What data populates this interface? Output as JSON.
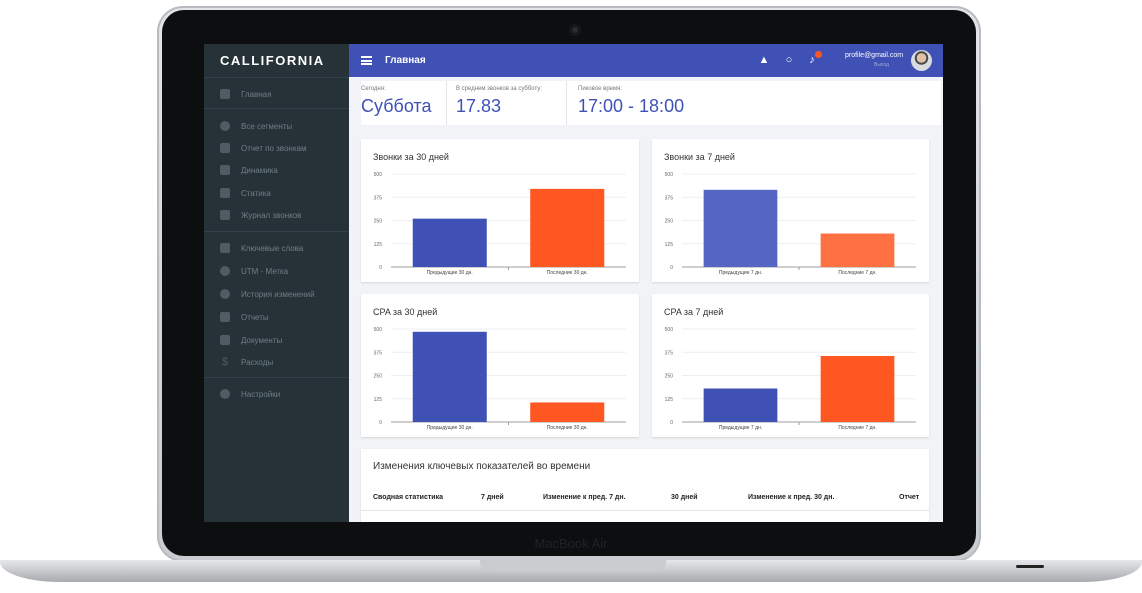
{
  "app": {
    "logo": "CALLIFORNIA",
    "page_title": "Главная"
  },
  "device": {
    "brand": "MacBook Air"
  },
  "sidebar": {
    "items": [
      {
        "label": "Главная",
        "icon": "home-icon"
      },
      {
        "label": "Все сегменты",
        "icon": "segments-icon"
      },
      {
        "label": "Отчет по звонкам",
        "icon": "phone-icon"
      },
      {
        "label": "Динамика",
        "icon": "bar-chart-icon"
      },
      {
        "label": "Статика",
        "icon": "columns-icon"
      },
      {
        "label": "Журнал звонков",
        "icon": "journal-icon"
      },
      {
        "label": "Ключевые слова",
        "icon": "tag-icon"
      },
      {
        "label": "UTM - Метка",
        "icon": "search-icon"
      },
      {
        "label": "История изменений",
        "icon": "history-icon"
      },
      {
        "label": "Отчеты",
        "icon": "report-icon"
      },
      {
        "label": "Документы",
        "icon": "document-icon"
      },
      {
        "label": "Расходы",
        "icon": "dollar-icon"
      },
      {
        "label": "Настройки",
        "icon": "gear-icon"
      }
    ]
  },
  "header": {
    "profile_email": "profile@gmail.com",
    "profile_sub": "Выход",
    "icons": [
      "school-icon",
      "bulb-icon",
      "bell-icon"
    ]
  },
  "stats": [
    {
      "label": "Сегодня:",
      "value": "Суббота"
    },
    {
      "label": "В среднем звонков за субботу:",
      "value": "17.83"
    },
    {
      "label": "Пиковое время:",
      "value": "17:00 - 18:00"
    }
  ],
  "colors": {
    "accent": "#3f51b5",
    "bar_prev": "#3f51b5",
    "bar_last": "#ff5722",
    "sidebar": "#263238"
  },
  "chart_data": [
    {
      "type": "bar",
      "title": "Звонки за 30 дней",
      "categories": [
        "Предыдущие 30 дн.",
        "Последние 30 дн."
      ],
      "values": [
        260,
        420
      ],
      "ylim": [
        0,
        500
      ],
      "yticks": [
        0,
        125,
        250,
        375,
        500
      ],
      "colors": [
        "#3f51b5",
        "#ff5722"
      ]
    },
    {
      "type": "bar",
      "title": "Звонки за 7 дней",
      "categories": [
        "Предыдущие 7 дн.",
        "Последние 7 дн."
      ],
      "values": [
        415,
        180
      ],
      "ylim": [
        0,
        500
      ],
      "yticks": [
        0,
        125,
        250,
        375,
        500
      ],
      "colors": [
        "#5567c2",
        "#ff7043"
      ]
    },
    {
      "type": "bar",
      "title": "CPA за 30 дней",
      "categories": [
        "Предыдущие 30 дн.",
        "Последние 30 дн."
      ],
      "values": [
        485,
        105
      ],
      "ylim": [
        0,
        500
      ],
      "yticks": [
        0,
        125,
        250,
        375,
        500
      ],
      "colors": [
        "#3f51b5",
        "#ff5722"
      ]
    },
    {
      "type": "bar",
      "title": "CPA за 7 дней",
      "categories": [
        "Предыдущие 7 дн.",
        "Последние 7 дн."
      ],
      "values": [
        180,
        355
      ],
      "ylim": [
        0,
        500
      ],
      "yticks": [
        0,
        125,
        250,
        375,
        500
      ],
      "colors": [
        "#3f51b5",
        "#ff5722"
      ]
    }
  ],
  "table": {
    "title": "Изменения ключевых показателей во времени",
    "headers": [
      "Сводная статистика",
      "7 дней",
      "Изменение к пред. 7 дн.",
      "30 дней",
      "Изменение к пред. 30 дн.",
      "Отчет"
    ]
  }
}
